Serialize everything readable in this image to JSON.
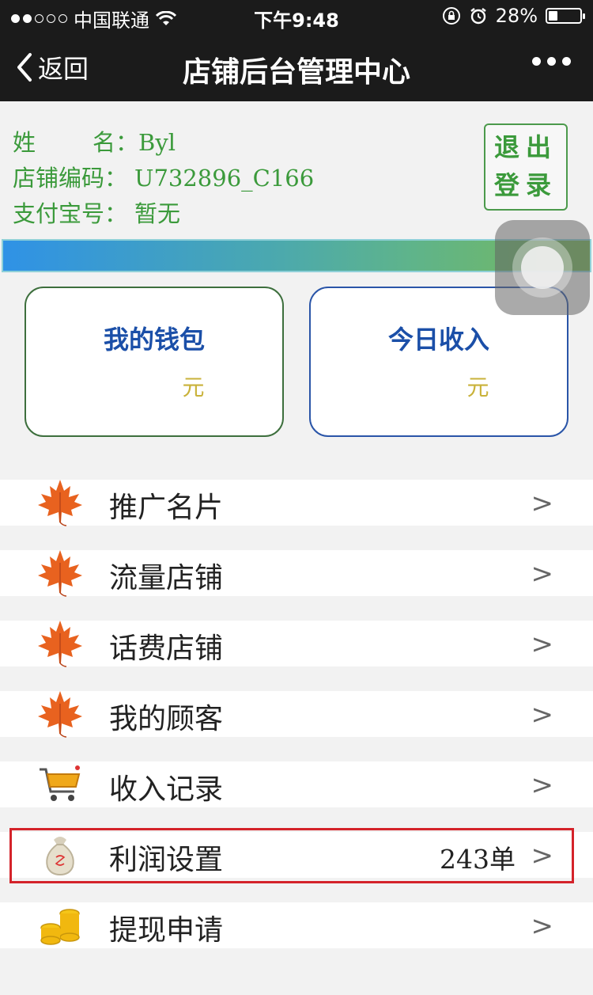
{
  "status_bar": {
    "carrier": "中国联通",
    "time": "下午9:48",
    "battery": "28%",
    "battery_level": 0.28
  },
  "nav": {
    "back_label": "返回",
    "title": "店铺后台管理中心"
  },
  "profile": {
    "name_label": [
      "姓",
      "名"
    ],
    "name_sep": "：",
    "name_value": "Byl",
    "code_label": "店铺编码：",
    "code_value": "U732896_C166",
    "alipay_label": "支付宝号：",
    "alipay_value": "暂无"
  },
  "logout": {
    "line1": "退出",
    "line2": "登录"
  },
  "cards": {
    "wallet": {
      "title": "我的钱包",
      "amount": "",
      "unit": "元"
    },
    "income": {
      "title": "今日收入",
      "amount": "",
      "unit": "元"
    }
  },
  "menu": [
    {
      "label": "推广名片",
      "icon": "maple-leaf-icon",
      "count": "",
      "chevron": ">"
    },
    {
      "label": "流量店铺",
      "icon": "maple-leaf-icon",
      "count": "",
      "chevron": ">"
    },
    {
      "label": "话费店铺",
      "icon": "maple-leaf-icon",
      "count": "",
      "chevron": ">"
    },
    {
      "label": "我的顾客",
      "icon": "maple-leaf-icon",
      "count": "",
      "chevron": ">"
    },
    {
      "label": "收入记录",
      "icon": "shopping-cart-icon",
      "count": "",
      "chevron": ">"
    },
    {
      "label": "利润设置",
      "icon": "money-bag-icon",
      "count": "243单",
      "chevron": ">"
    },
    {
      "label": "提现申请",
      "icon": "gold-coins-icon",
      "count": "",
      "chevron": ">"
    }
  ],
  "colors": {
    "nav_bg": "#1b1b1b",
    "info_green": "#3b9a3b",
    "card_title_blue": "#1b4fa8",
    "unit_gold": "#c9b23a",
    "highlight_red": "#d4232a"
  }
}
